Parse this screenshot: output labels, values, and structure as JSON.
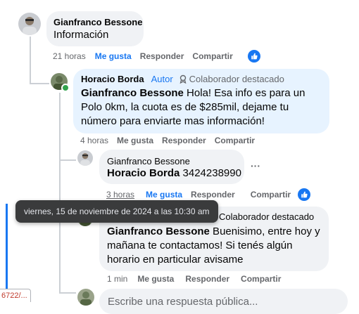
{
  "comment1": {
    "author": "Gianfranco Bessone",
    "text": "Información",
    "time": "21 horas",
    "like": "Me gusta",
    "reply": "Responder",
    "share": "Compartir"
  },
  "comment2": {
    "author": "Horacio Borda",
    "author_tag": "Autor",
    "badge": "Colaborador destacado",
    "mention": "Gianfranco Bessone",
    "text": " Hola! Esa info es para un Polo 0km, la cuota es de $285mil, dejame tu número para enviarte mas información!",
    "time": "4 horas",
    "like": "Me gusta",
    "reply": "Responder",
    "share": "Compartir"
  },
  "comment3": {
    "author": "Gianfranco Bessone",
    "mention": "Horacio Borda",
    "text": " 3424238990",
    "more": "···",
    "time": "3 horas",
    "like": "Me gusta",
    "reply": "Responder",
    "share": "Compartir"
  },
  "comment4": {
    "badge": "Colaborador destacado",
    "mention": "Gianfranco Bessone",
    "text": " Buenisimo, entre hoy y mañana te contactamos! Si tenés algún horario en particular avisame",
    "time": "1 min",
    "like": "Me gusta",
    "reply": "Responder",
    "share": "Compartir"
  },
  "tooltip": "viernes, 15 de noviembre de 2024 a las 10:30 am",
  "reply_placeholder": "Escribe una respuesta pública...",
  "url_fragment": "6722/...",
  "colors": {
    "accent": "#1877f2",
    "bubble": "#f0f2f5",
    "bubble_highlight": "#e7f3ff",
    "muted": "#65676b"
  }
}
